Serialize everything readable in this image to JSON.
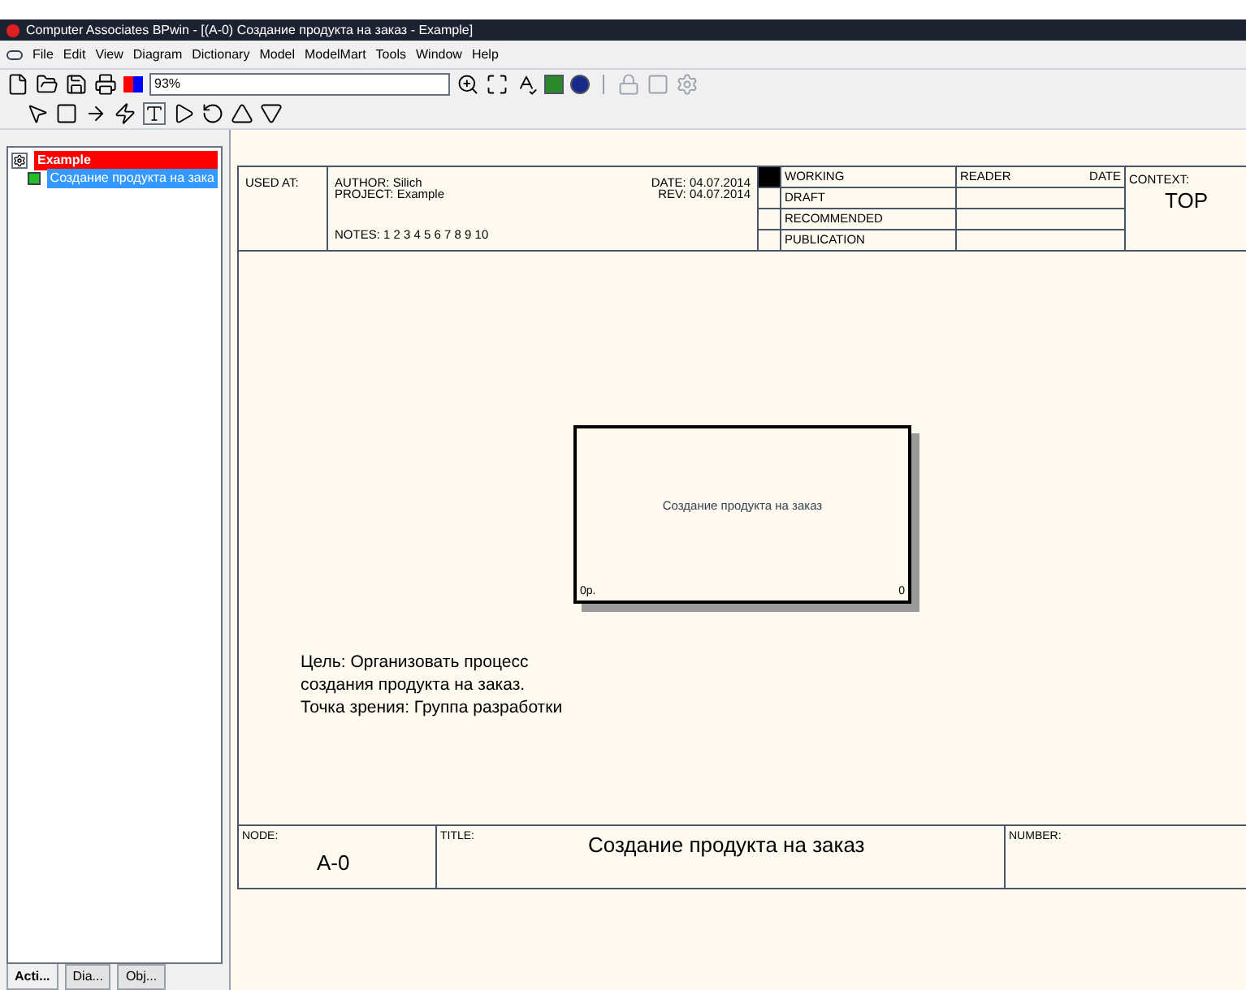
{
  "window": {
    "title": "Computer Associates BPwin - [(A-0) Создание продукта на заказ - Example]"
  },
  "menu": [
    "File",
    "Edit",
    "View",
    "Diagram",
    "Dictionary",
    "Model",
    "ModelMart",
    "Tools",
    "Window",
    "Help"
  ],
  "zoom": {
    "value": "93%"
  },
  "tree": [
    {
      "label": "Example",
      "kind": "model",
      "selected": false,
      "children": [
        {
          "label": "Создание продукта на зака",
          "kind": "activity",
          "selected": true
        }
      ]
    }
  ],
  "panel_tabs": [
    {
      "label": "Acti...",
      "selected": true
    },
    {
      "label": "Dia...",
      "selected": false
    },
    {
      "label": "Obj...",
      "selected": false
    }
  ],
  "header": {
    "used_at": "USED AT:",
    "author": "AUTHOR:  Silich",
    "project": "PROJECT:  Example",
    "notes": "NOTES:  1  2  3  4  5  6  7  8  9  10",
    "date": "DATE:  04.07.2014",
    "rev": "REV:    04.07.2014",
    "statuses": [
      {
        "label": "WORKING",
        "selected": true
      },
      {
        "label": "DRAFT",
        "selected": false
      },
      {
        "label": "RECOMMENDED",
        "selected": false
      },
      {
        "label": "PUBLICATION",
        "selected": false
      }
    ],
    "reader": "READER",
    "reader_date": "DATE",
    "context": "CONTEXT:",
    "context_value": "TOP"
  },
  "activity": {
    "name": "Создание продукта на заказ",
    "cost": "0р.",
    "number": "0"
  },
  "note": [
    "Цель:  Организовать процесс",
    "создания продукта на заказ.",
    "Точка зрения: Группа разработки"
  ],
  "footer": {
    "node_label": "NODE:",
    "node": "A-0",
    "title_label": "TITLE:",
    "title": "Создание продукта на заказ",
    "number_label": "NUMBER:"
  }
}
